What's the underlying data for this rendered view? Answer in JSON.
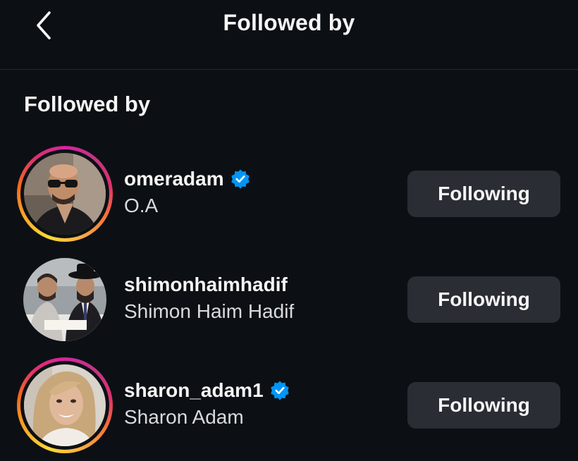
{
  "header": {
    "title": "Followed by",
    "back_icon": "chevron-left-icon"
  },
  "section": {
    "title": "Followed by"
  },
  "users": [
    {
      "username": "omeradam",
      "full_name": "O.A",
      "verified": true,
      "story_ring": true,
      "button_label": "Following"
    },
    {
      "username": "shimonhaimhadif",
      "full_name": "Shimon Haim Hadif",
      "verified": false,
      "story_ring": false,
      "button_label": "Following"
    },
    {
      "username": "sharon_adam1",
      "full_name": "Sharon Adam",
      "verified": true,
      "story_ring": true,
      "button_label": "Following"
    }
  ],
  "colors": {
    "background": "#0c1014",
    "button_bg": "#2a2d33",
    "verified_blue": "#0095f6",
    "text_primary": "#f5f5f5"
  }
}
